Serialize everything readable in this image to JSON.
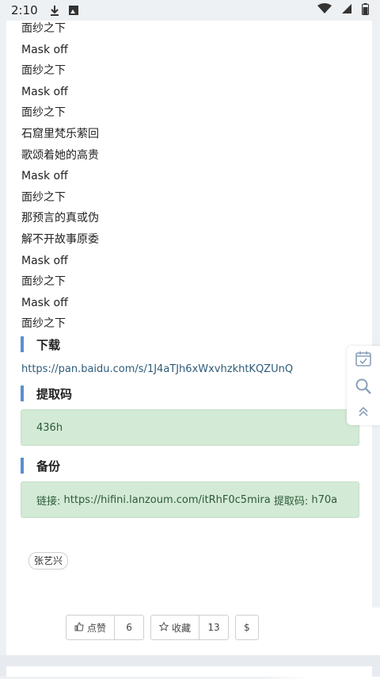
{
  "status": {
    "time": "2:10"
  },
  "lyrics": [
    "面纱之下",
    "Mask off",
    "面纱之下",
    "Mask off",
    "面纱之下",
    "石窟里梵乐萦回",
    "歌颂着她的高贵",
    "Mask off",
    "面纱之下",
    "那预言的真或伪",
    "解不开故事原委",
    "Mask off",
    "面纱之下",
    "Mask off",
    "面纱之下"
  ],
  "download": {
    "heading": "下载",
    "url": "https://pan.baidu.com/s/1J4aTJh6xWxvhzkhtKQZUnQ"
  },
  "extract": {
    "heading": "提取码",
    "code": "436h"
  },
  "backup": {
    "heading": "备份",
    "link_label": "链接:",
    "url": "https://hifini.lanzoum.com/itRhF0c5mira",
    "code_label": "提取码:",
    "code": "h70a"
  },
  "tag": "张艺兴",
  "actions": {
    "like_label": "点赞",
    "like_count": "6",
    "fav_label": "收藏",
    "fav_count": "13",
    "tip_label": "$"
  }
}
